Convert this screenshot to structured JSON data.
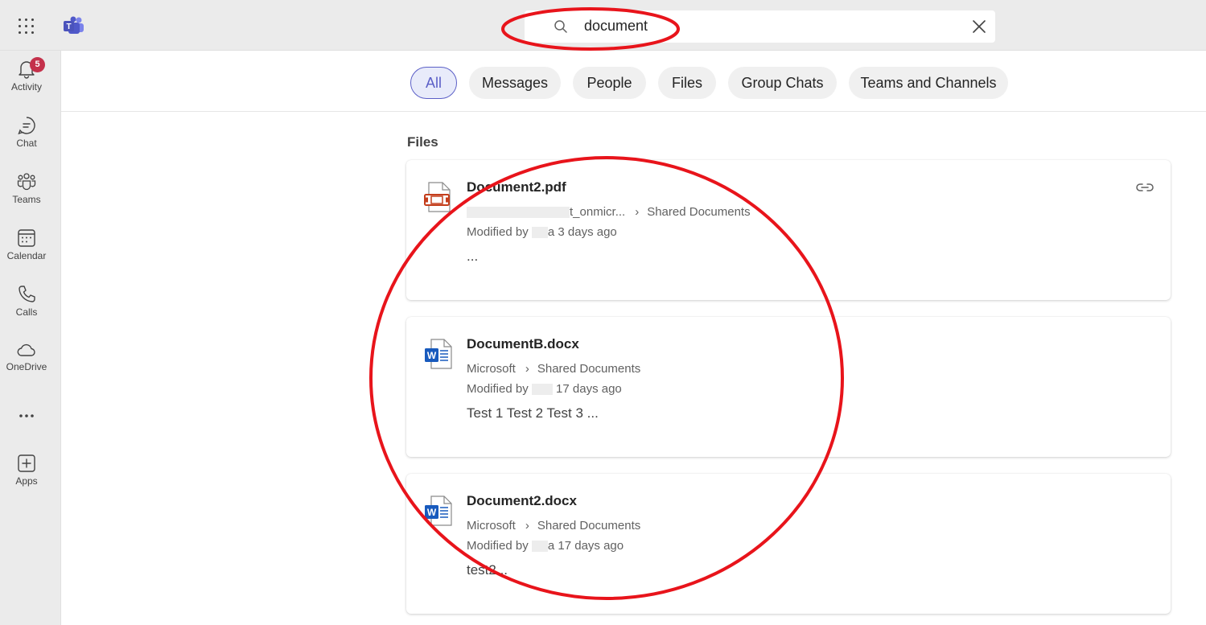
{
  "search": {
    "query": "document"
  },
  "rail": [
    {
      "label": "Activity",
      "badge": "5",
      "icon": "bell-icon"
    },
    {
      "label": "Chat",
      "icon": "chat-icon"
    },
    {
      "label": "Teams",
      "icon": "teams-icon"
    },
    {
      "label": "Calendar",
      "icon": "calendar-icon"
    },
    {
      "label": "Calls",
      "icon": "phone-icon"
    },
    {
      "label": "OneDrive",
      "icon": "cloud-icon"
    },
    {
      "label": "",
      "icon": "more-icon"
    },
    {
      "label": "Apps",
      "icon": "add-apps-icon"
    }
  ],
  "tabs": [
    {
      "label": "All",
      "active": true
    },
    {
      "label": "Messages"
    },
    {
      "label": "People"
    },
    {
      "label": "Files"
    },
    {
      "label": "Group Chats"
    },
    {
      "label": "Teams and Channels"
    }
  ],
  "section_title": "Files",
  "results": [
    {
      "name": "Document2.pdf",
      "type": "pdf",
      "path_start": "t_onmicr...",
      "path_end": "Shared Documents",
      "modified_prefix": "Modified by ",
      "modified_suffix": "a 3 days ago",
      "snippet": "..."
    },
    {
      "name": "DocumentB.docx",
      "type": "word",
      "path_start": "Microsoft",
      "path_end": "Shared Documents",
      "modified_prefix": "Modified by ",
      "modified_suffix": "17 days ago",
      "snippet": "Test 1 Test 2 Test 3 ..."
    },
    {
      "name": "Document2.docx",
      "type": "word",
      "path_start": "Microsoft",
      "path_end": "Shared Documents",
      "modified_prefix": "Modified by ",
      "modified_suffix": "a 17 days ago",
      "snippet": "test2..."
    }
  ],
  "path_separator": "›",
  "colors": {
    "accent": "#5b5fc7",
    "badge": "#c4314b",
    "annotation": "#e8141b",
    "word_blue": "#185abd",
    "pdf_red": "#c43e1c"
  }
}
